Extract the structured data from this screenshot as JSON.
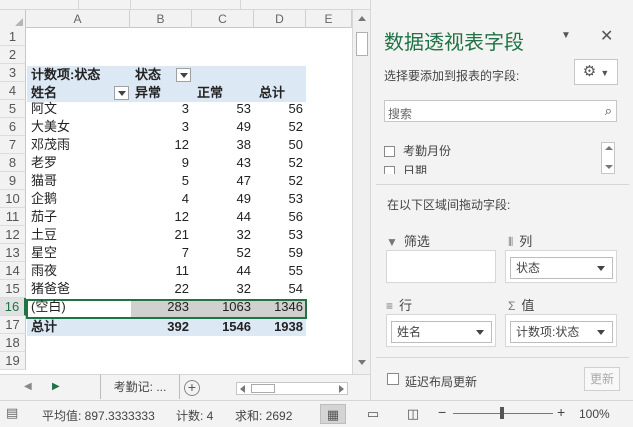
{
  "columns": [
    "A",
    "B",
    "C",
    "D",
    "E"
  ],
  "rows": [
    "1",
    "2",
    "3",
    "4",
    "5",
    "6",
    "7",
    "8",
    "9",
    "10",
    "11",
    "12",
    "13",
    "14",
    "15",
    "16",
    "17",
    "18",
    "19"
  ],
  "pivot": {
    "count_label": "计数项:状态",
    "col_field": "状态",
    "row_field": "姓名",
    "col_headers": [
      "异常",
      "正常",
      "总计"
    ],
    "records": [
      {
        "name": "阿文",
        "abnormal": "3",
        "normal": "53",
        "total": "56"
      },
      {
        "name": "大美女",
        "abnormal": "3",
        "normal": "49",
        "total": "52"
      },
      {
        "name": "邓茂雨",
        "abnormal": "12",
        "normal": "38",
        "total": "50"
      },
      {
        "name": "老罗",
        "abnormal": "9",
        "normal": "43",
        "total": "52"
      },
      {
        "name": "猫哥",
        "abnormal": "5",
        "normal": "47",
        "total": "52"
      },
      {
        "name": "企鹅",
        "abnormal": "4",
        "normal": "49",
        "total": "53"
      },
      {
        "name": "茄子",
        "abnormal": "12",
        "normal": "44",
        "total": "56"
      },
      {
        "name": "土豆",
        "abnormal": "21",
        "normal": "32",
        "total": "53"
      },
      {
        "name": "星空",
        "abnormal": "7",
        "normal": "52",
        "total": "59"
      },
      {
        "name": "雨夜",
        "abnormal": "11",
        "normal": "44",
        "total": "55"
      },
      {
        "name": "猪爸爸",
        "abnormal": "22",
        "normal": "32",
        "total": "54"
      },
      {
        "name": "(空白)",
        "abnormal": "283",
        "normal": "1063",
        "total": "1346"
      }
    ],
    "grand_total": {
      "label": "总计",
      "abnormal": "392",
      "normal": "1546",
      "total": "1938"
    }
  },
  "sheet_tabs": {
    "active": "考勤记: ..."
  },
  "status_bar": {
    "average": "平均值: 897.3333333",
    "count": "计数: 4",
    "sum": "求和: 2692",
    "zoom": "100%"
  },
  "field_pane": {
    "title": "数据透视表字段",
    "choose_fields_label": "选择要添加到报表的字段:",
    "search_placeholder": "搜索",
    "fields": [
      "考勤月份",
      "日期"
    ],
    "drag_label": "在以下区域间拖动字段:",
    "areas": {
      "filter": {
        "label": "筛选"
      },
      "columns": {
        "label": "列",
        "value": "状态"
      },
      "rows": {
        "label": "行",
        "value": "姓名"
      },
      "values": {
        "label": "值",
        "value": "计数项:状态"
      }
    },
    "defer_label": "延迟布局更新",
    "update_button": "更新"
  },
  "colors": {
    "accent": "#217346",
    "pivot_header": "#dde8f5"
  }
}
